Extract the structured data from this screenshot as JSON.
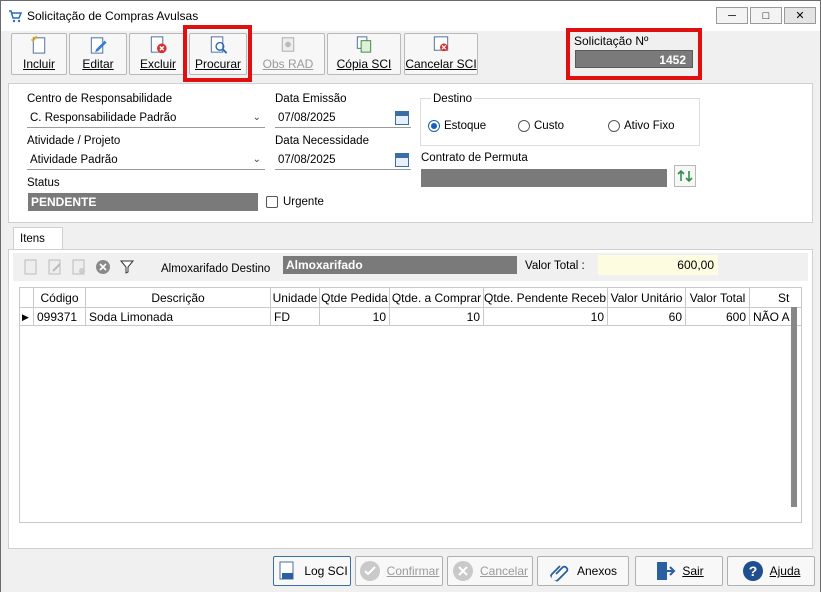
{
  "window": {
    "title": "Solicitação de Compras Avulsas"
  },
  "toolbar": {
    "incluir": "Incluir",
    "editar": "Editar",
    "excluir": "Excluir",
    "procurar": "Procurar",
    "obs_rad": "Obs RAD",
    "copia_sci": "Cópia SCI",
    "cancelar_sci": "Cancelar SCI"
  },
  "solicitacao": {
    "label": "Solicitação Nº",
    "value": "1452"
  },
  "form": {
    "centro_label": "Centro de Responsabilidade",
    "centro_value": "C. Responsabilidade Padrão",
    "data_emissao_label": "Data Emissão",
    "data_emissao_value": "07/08/2025",
    "atividade_label": "Atividade / Projeto",
    "atividade_value": "Atividade Padrão",
    "data_necessidade_label": "Data Necessidade",
    "data_necessidade_value": "07/08/2025",
    "status_label": "Status",
    "status_value": "PENDENTE",
    "urgente_label": "Urgente",
    "destino_label": "Destino",
    "destino_estoque": "Estoque",
    "destino_custo": "Custo",
    "destino_ativo": "Ativo Fixo",
    "contrato_label": "Contrato de Permuta"
  },
  "itens": {
    "tab_label": "Itens",
    "almox_label": "Almoxarifado Destino",
    "almox_value": "Almoxarifado",
    "valor_total_label": "Valor Total :",
    "valor_total_value": "600,00",
    "columns": [
      "Código",
      "Descrição",
      "Unidade",
      "Qtde Pedida",
      "Qtde. a Comprar",
      "Qtde. Pendente Receb.",
      "Valor Unitário",
      "Valor Total",
      "St"
    ],
    "rows": [
      [
        "099371",
        "Soda Limonada",
        "FD",
        "10",
        "10",
        "10",
        "60",
        "600",
        "NÃO A"
      ]
    ]
  },
  "bottom": {
    "log_sci": "Log SCI",
    "confirmar": "Confirmar",
    "cancelar": "Cancelar",
    "anexos": "Anexos",
    "sair": "Sair",
    "ajuda": "Ajuda"
  }
}
